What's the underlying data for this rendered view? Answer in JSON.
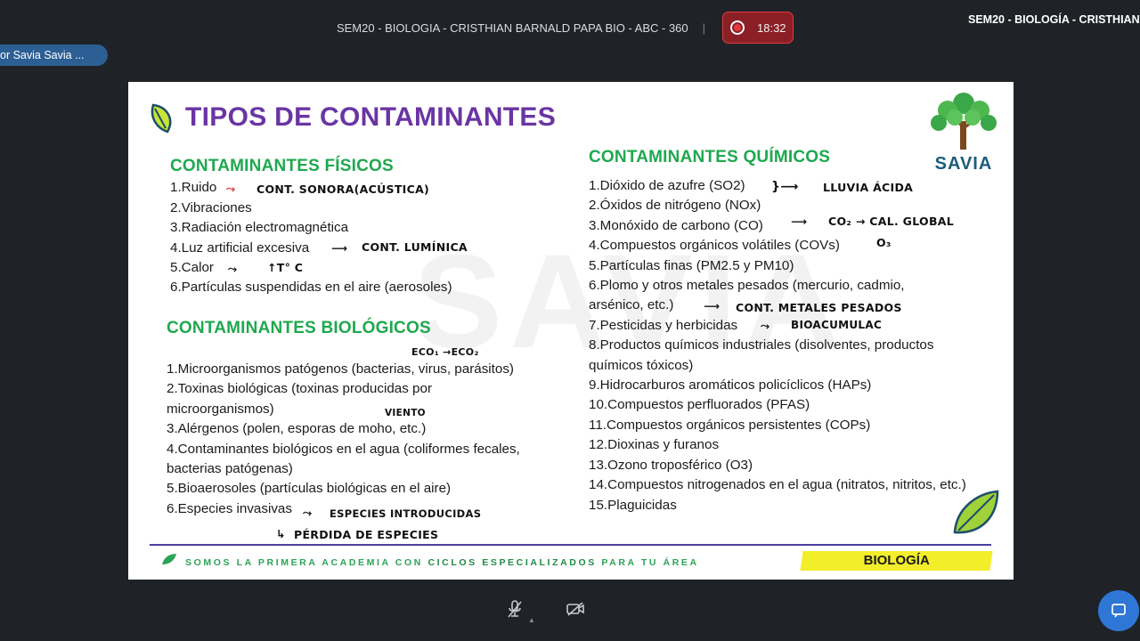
{
  "meeting": {
    "title": "SEM20 - BIOLOGIA - CRISTHIAN BARNALD PAPA BIO - ABC - 360",
    "separator": "|",
    "timer": "18:32",
    "right_title": "SEM20 - BIOLOGÍA - CRISTHIAN",
    "participant_pill": "or Savia Savia ..."
  },
  "slide": {
    "title": "TIPOS DE CONTAMINANTES",
    "watermark": "SAVIA",
    "logo_text": "SAVIA",
    "fisicos": {
      "title": "CONTAMINANTES FÍSICOS",
      "items": [
        "1.Ruido",
        "2.Vibraciones",
        "3.Radiación electromagnética",
        "4.Luz artificial excesiva",
        "5.Calor",
        "6.Partículas suspendidas en el aire (aerosoles)"
      ]
    },
    "biologicos": {
      "title": "CONTAMINANTES BIOLÓGICOS",
      "items": [
        "1.Microorganismos patógenos (bacterias, virus, parásitos)",
        "2.Toxinas biológicas (toxinas producidas por microorganismos)",
        "3.Alérgenos (polen, esporas de moho, etc.)",
        "4.Contaminantes biológicos en el agua (coliformes fecales, bacterias patógenas)",
        "5.Bioaerosoles (partículas biológicas en el aire)",
        "6.Especies invasivas"
      ]
    },
    "quimicos": {
      "title": "CONTAMINANTES QUÍMICOS",
      "items": [
        "1.Dióxido de azufre (SO2)",
        "2.Óxidos de nitrógeno (NOx)",
        "3.Monóxido de carbono (CO)",
        "4.Compuestos orgánicos volátiles (COVs)",
        "5.Partículas finas (PM2.5 y PM10)",
        "6.Plomo y otros metales pesados (mercurio, cadmio, arsénico, etc.)",
        "7.Pesticidas y herbicidas",
        "8.Productos químicos industriales (disolventes, productos químicos tóxicos)",
        "9.Hidrocarburos aromáticos policíclicos (HAPs)",
        "10.Compuestos perfluorados (PFAS)",
        "11.Compuestos orgánicos persistentes (COPs)",
        "12.Dioxinas y furanos",
        "13.Ozono troposférico (O3)",
        "14.Compuestos nitrogenados en el agua (nitratos, nitritos, etc.)",
        "15.Plaguicidas"
      ]
    },
    "handwriting": {
      "ruido": "CONT. SONORA(ACÚSTICA)",
      "luz": "CONT. LUMÍNICA",
      "calor": "↑T° C",
      "eco": "ECO₁ →ECO₂",
      "viento": "VIENTO",
      "invasivas": "ESPECIES INTRODUCIDAS",
      "perdida": "PÉRDIDA DE ESPECIES",
      "lluvia": "LLUVIA ÁCIDA",
      "co2": "CO₂ → CAL. GLOBAL",
      "covs": "O₃",
      "metales": "CONT. METALES PESADOS",
      "pesticidas": "BIOACUMULAC"
    },
    "footer": {
      "text_a": "SOMOS LA PRIMERA ACADEMIA CON ",
      "text_b": "CICLOS ESPECIALIZADOS",
      "text_c": " PARA TU ÁREA",
      "tag": "BIOLOGÍA"
    }
  },
  "colors": {
    "title_purple": "#6a35a3",
    "section_green": "#1fa84e",
    "record_red": "#e03a40",
    "tag_yellow": "#f3ee2a",
    "fab_blue": "#2f77d6"
  },
  "toolbar": {
    "icons": [
      "microphone-muted-icon",
      "camera-off-icon",
      "chat-icon"
    ]
  }
}
